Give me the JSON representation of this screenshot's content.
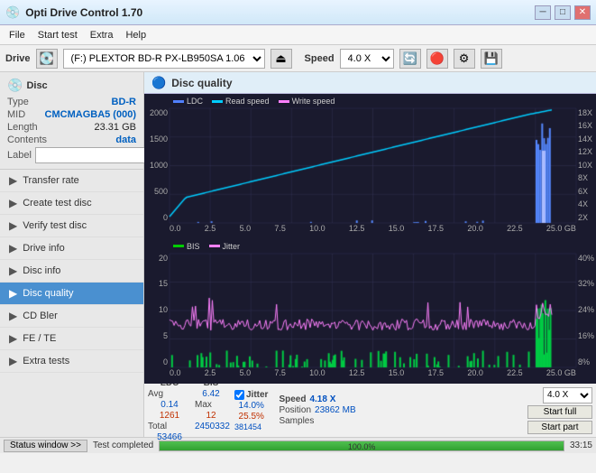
{
  "titlebar": {
    "icon": "💿",
    "title": "Opti Drive Control 1.70",
    "min_label": "─",
    "max_label": "□",
    "close_label": "✕"
  },
  "menu": {
    "items": [
      "File",
      "Start test",
      "Extra",
      "Help"
    ]
  },
  "drivebar": {
    "drive_label": "Drive",
    "drive_value": "(F:) PLEXTOR BD-R  PX-LB950SA 1.06",
    "speed_label": "Speed",
    "speed_value": "4.0 X"
  },
  "disc": {
    "title": "Disc",
    "type_label": "Type",
    "type_value": "BD-R",
    "mid_label": "MID",
    "mid_value": "CMCMAGBA5 (000)",
    "length_label": "Length",
    "length_value": "23.31 GB",
    "contents_label": "Contents",
    "contents_value": "data",
    "label_label": "Label",
    "label_value": ""
  },
  "sidebar": {
    "items": [
      {
        "label": "Transfer rate",
        "icon": "📈"
      },
      {
        "label": "Create test disc",
        "icon": "💿"
      },
      {
        "label": "Verify test disc",
        "icon": "✅"
      },
      {
        "label": "Drive info",
        "icon": "ℹ️"
      },
      {
        "label": "Disc info",
        "icon": "📄"
      },
      {
        "label": "Disc quality",
        "icon": "🔵",
        "active": true
      },
      {
        "label": "CD Bler",
        "icon": "📊"
      },
      {
        "label": "FE / TE",
        "icon": "📉"
      },
      {
        "label": "Extra tests",
        "icon": "🔧"
      }
    ]
  },
  "disc_quality": {
    "title": "Disc quality",
    "legend": [
      {
        "label": "LDC",
        "color": "#5080ff"
      },
      {
        "label": "Read speed",
        "color": "#00ccff"
      },
      {
        "label": "Write speed",
        "color": "#ff80ff"
      }
    ],
    "top_chart": {
      "y_left": [
        "2000",
        "1500",
        "1000",
        "500",
        "0"
      ],
      "y_right": [
        "18X",
        "16X",
        "14X",
        "12X",
        "10X",
        "8X",
        "6X",
        "4X",
        "2X"
      ],
      "x": [
        "0.0",
        "2.5",
        "5.0",
        "7.5",
        "10.0",
        "12.5",
        "15.0",
        "17.5",
        "20.0",
        "22.5",
        "25.0 GB"
      ]
    },
    "bottom_chart": {
      "legend": [
        {
          "label": "BIS",
          "color": "#00cc00"
        },
        {
          "label": "Jitter",
          "color": "#ff80ff"
        }
      ],
      "y_left": [
        "20",
        "15",
        "10",
        "5",
        "0"
      ],
      "y_right": [
        "40%",
        "32%",
        "24%",
        "16%",
        "8%"
      ],
      "x": [
        "0.0",
        "2.5",
        "5.0",
        "7.5",
        "10.0",
        "12.5",
        "15.0",
        "17.5",
        "20.0",
        "22.5",
        "25.0 GB"
      ]
    }
  },
  "stats": {
    "ldc_header": "LDC",
    "bis_header": "BIS",
    "jitter_header": "Jitter",
    "jitter_checked": true,
    "speed_header": "Speed",
    "speed_value": "4.18 X",
    "speed_select": "4.0 X",
    "avg_label": "Avg",
    "ldc_avg": "6.42",
    "bis_avg": "0.14",
    "jitter_avg": "14.0%",
    "max_label": "Max",
    "ldc_max": "1261",
    "bis_max": "12",
    "jitter_max": "25.5%",
    "position_label": "Position",
    "position_value": "23862 MB",
    "total_label": "Total",
    "ldc_total": "2450332",
    "bis_total": "53466",
    "samples_label": "Samples",
    "samples_value": "381454",
    "start_full_label": "Start full",
    "start_part_label": "Start part"
  },
  "statusbar": {
    "window_btn": "Status window >>",
    "status_text": "Test completed",
    "progress": 100,
    "time": "33:15"
  }
}
